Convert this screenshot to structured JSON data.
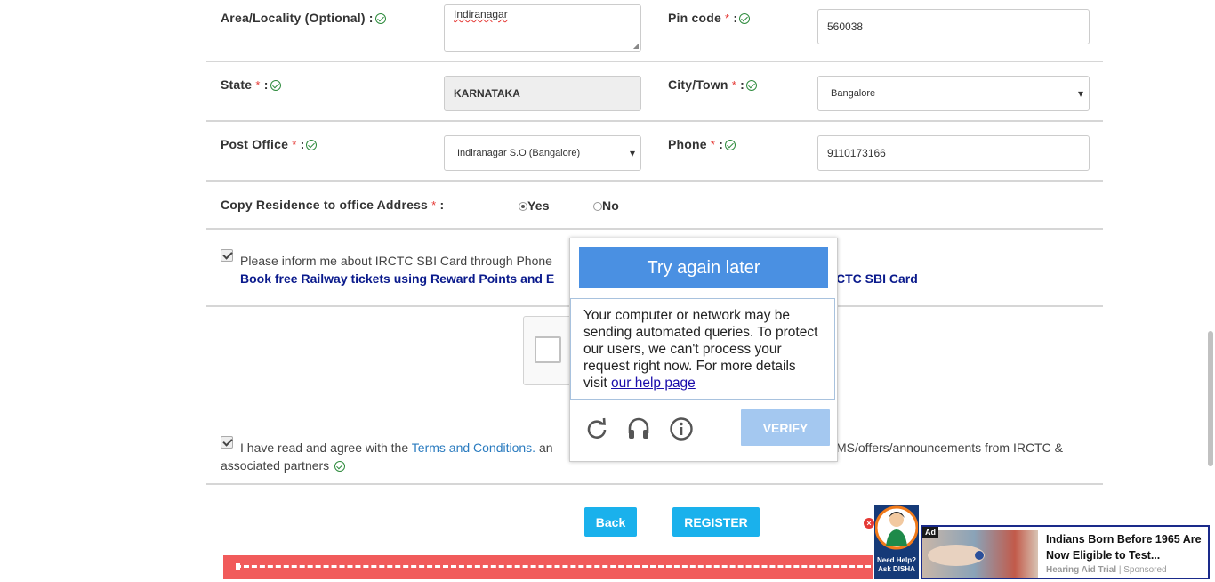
{
  "form": {
    "area_label": "Area/Locality (Optional) :",
    "area_value": "Indiranagar",
    "pin_label": "Pin code",
    "pin_value": "560038",
    "state_label": "State",
    "state_value": "KARNATAKA",
    "city_label": "City/Town",
    "city_value": "Bangalore",
    "post_label": "Post Office",
    "post_value": "Indiranagar S.O (Bangalore)",
    "phone_label": "Phone",
    "phone_value": "9110173166",
    "req_star": "*",
    "colon": ":",
    "copy_label": "Copy Residence to office Address",
    "copy_colon": ":",
    "yes_label": "Yes",
    "no_label": "No",
    "copy_selected": "Yes"
  },
  "consent": {
    "inform_text": "Please inform me about IRCTC SBI Card through Phone",
    "sbi_link_left": "Book free Railway tickets using Reward Points and E",
    "sbi_link_right": "CTC SBI Card",
    "terms_prefix": "I have read and agree with the ",
    "terms_link": "Terms and Conditions.",
    "terms_mid": " an",
    "terms_suffix": "MS/offers/announcements from IRCTC &",
    "terms_line2": "associated partners"
  },
  "captcha": {
    "header": "Try again later",
    "message": "Your computer or network may be sending automated queries. To protect our users, we can't process your request right now. For more details visit ",
    "help_link": "our help page",
    "verify_label": "VERIFY",
    "icons": [
      "reload-icon",
      "headphones-icon",
      "info-icon"
    ]
  },
  "buttons": {
    "back": "Back",
    "register": "REGISTER"
  },
  "disha": {
    "line1": "Need Help?",
    "line2": "Ask DISHA"
  },
  "ad": {
    "badge": "Ad",
    "headline": "Indians Born Before 1965 Are Now Eligible to Test...",
    "source": "Hearing Aid Trial",
    "sponsored": "Sponsored",
    "separator": " | "
  },
  "colors": {
    "accent": "#1ab1ec",
    "captcha_blue": "#4a90e2",
    "link_navy": "#0a1a8c",
    "banner_red": "#f15b5b",
    "check_green": "#2e8b3d"
  }
}
